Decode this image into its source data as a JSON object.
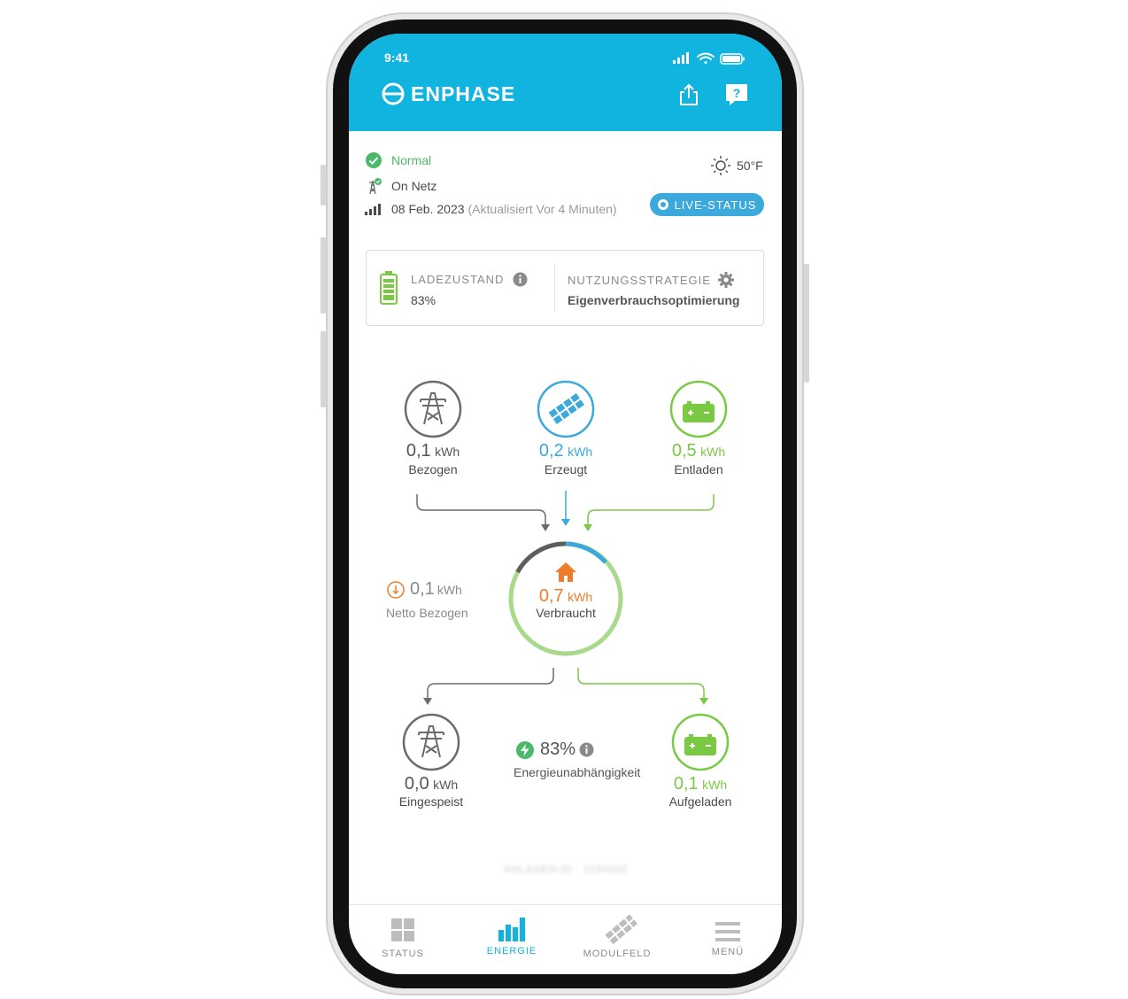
{
  "statusbar": {
    "time": "9:41"
  },
  "header": {
    "brand": "ENPHASE"
  },
  "system": {
    "status": "Normal",
    "grid": "On Netz",
    "date": "08 Feb. 2023",
    "updated": "(Aktualisiert Vor 4 Minuten)",
    "temperature": "50°F",
    "live_label": "LIVE-STATUS"
  },
  "battery_card": {
    "charge_label": "LADEZUSTAND",
    "charge_value": "83%",
    "charge_level": 0.83,
    "strategy_label": "NUTZUNGSSTRATEGIE",
    "strategy_value": "Eigenverbrauchsoptimierung"
  },
  "energy": {
    "unit": "kWh",
    "imported": {
      "value": "0,1",
      "label": "Bezogen"
    },
    "produced": {
      "value": "0,2",
      "label": "Erzeugt"
    },
    "discharged": {
      "value": "0,5",
      "label": "Entladen"
    },
    "net": {
      "value": "0,1",
      "label": "Netto Bezogen"
    },
    "consumed": {
      "value": "0,7",
      "label": "Verbraucht"
    },
    "exported": {
      "value": "0,0",
      "label": "Eingespeist"
    },
    "charged": {
      "value": "0,1",
      "label": "Aufgeladen"
    },
    "independence": {
      "value": "83%",
      "label": "Energieunabhängigkeit"
    }
  },
  "footer": {
    "system_id": "ANLAGEN-ID · 2284002"
  },
  "tabs": [
    {
      "label": "STATUS"
    },
    {
      "label": "ENERGIE"
    },
    {
      "label": "MODULFELD"
    },
    {
      "label": "MENÜ"
    }
  ],
  "colors": {
    "brand": "#10b4df",
    "grid": "#6b6b6b",
    "solar": "#3ba9dc",
    "battery": "#7ac943",
    "home": "#f07c2b",
    "status_ok": "#4cb96a"
  }
}
